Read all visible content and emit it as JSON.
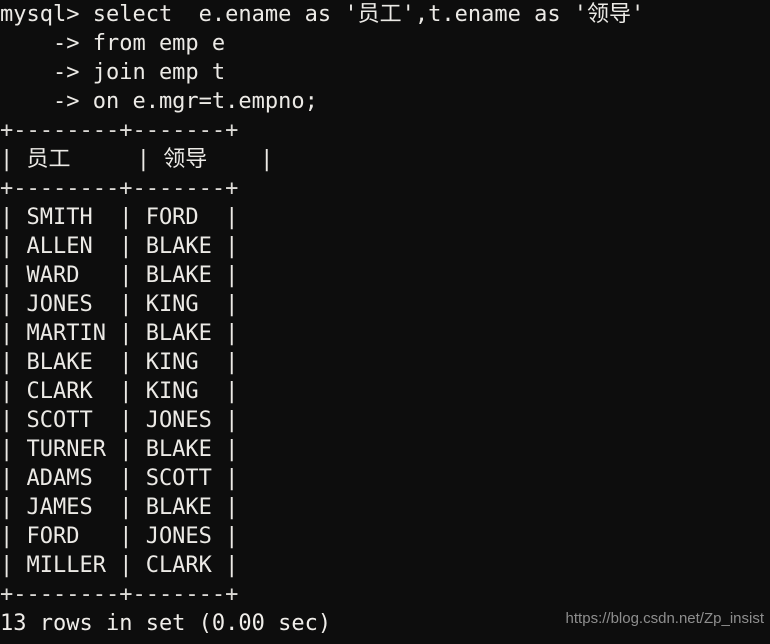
{
  "terminal": {
    "prompt": "mysql>",
    "continuation_prompt": "->",
    "background_color": "#0d0d0d",
    "text_color": "#e8e6e3",
    "query_lines": [
      "mysql> select  e.ename as '员工',t.ename as '领导'",
      "    -> from emp e",
      "    -> join emp t",
      "    -> on e.mgr=t.empno;"
    ],
    "separator": "+--------+-------+",
    "header_line": "| 员工     | 领导    |",
    "result_table": {
      "headers": [
        "员工",
        "领导"
      ],
      "rows": [
        [
          "SMITH",
          "FORD"
        ],
        [
          "ALLEN",
          "BLAKE"
        ],
        [
          "WARD",
          "BLAKE"
        ],
        [
          "JONES",
          "KING"
        ],
        [
          "MARTIN",
          "BLAKE"
        ],
        [
          "BLAKE",
          "KING"
        ],
        [
          "CLARK",
          "KING"
        ],
        [
          "SCOTT",
          "JONES"
        ],
        [
          "TURNER",
          "BLAKE"
        ],
        [
          "ADAMS",
          "SCOTT"
        ],
        [
          "JAMES",
          "BLAKE"
        ],
        [
          "FORD",
          "JONES"
        ],
        [
          "MILLER",
          "CLARK"
        ]
      ],
      "row_lines": [
        "| SMITH  | FORD  |",
        "| ALLEN  | BLAKE |",
        "| WARD   | BLAKE |",
        "| JONES  | KING  |",
        "| MARTIN | BLAKE |",
        "| BLAKE  | KING  |",
        "| CLARK  | KING  |",
        "| SCOTT  | JONES |",
        "| TURNER | BLAKE |",
        "| ADAMS  | SCOTT |",
        "| JAMES  | BLAKE |",
        "| FORD   | JONES |",
        "| MILLER | CLARK |"
      ]
    },
    "status_line": "13 rows in set (0.00 sec)",
    "row_count": "13",
    "elapsed": "0.00 sec"
  },
  "watermark": {
    "text": "https://blog.csdn.net/Zp_insist",
    "color": "#8e8e8e"
  }
}
